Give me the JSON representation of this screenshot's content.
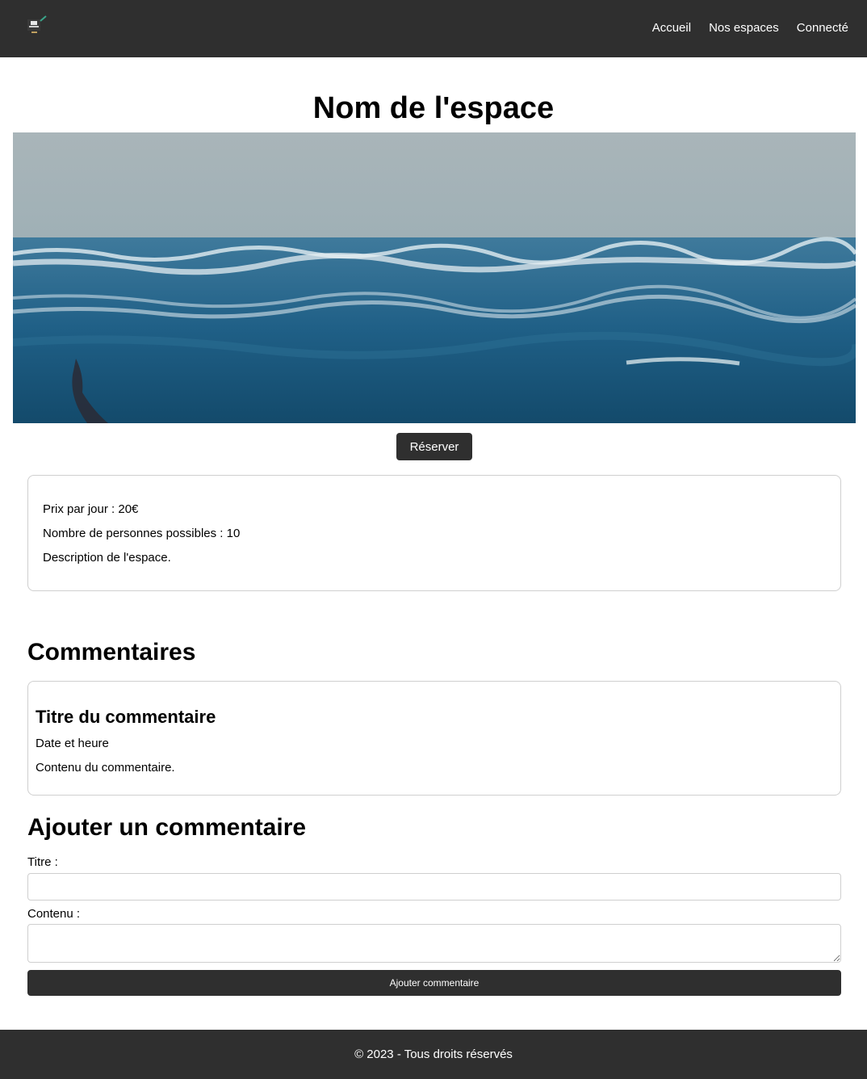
{
  "header": {
    "logo_icon": "app-logo-icon",
    "nav": [
      "Accueil",
      "Nos espaces",
      "Connecté"
    ]
  },
  "space": {
    "name": "Nom de l'espace",
    "reserve_label": "Réserver",
    "price": "Prix par jour : 20€",
    "capacity": "Nombre de personnes possibles : 10",
    "description": "Description de l'espace."
  },
  "comments": {
    "title": "Commentaires",
    "items": [
      {
        "title": "Titre du commentaire",
        "datetime": "Date et heure",
        "content": "Contenu du commentaire."
      }
    ]
  },
  "add_comment": {
    "title": "Ajouter un commentaire",
    "title_label": "Titre :",
    "title_value": "",
    "content_label": "Contenu :",
    "content_value": "",
    "submit_label": "Ajouter commentaire"
  },
  "footer": {
    "text": "© 2023 - Tous droits réservés"
  },
  "colors": {
    "bar": "#2f2f2f",
    "border": "#cfcfcf"
  }
}
